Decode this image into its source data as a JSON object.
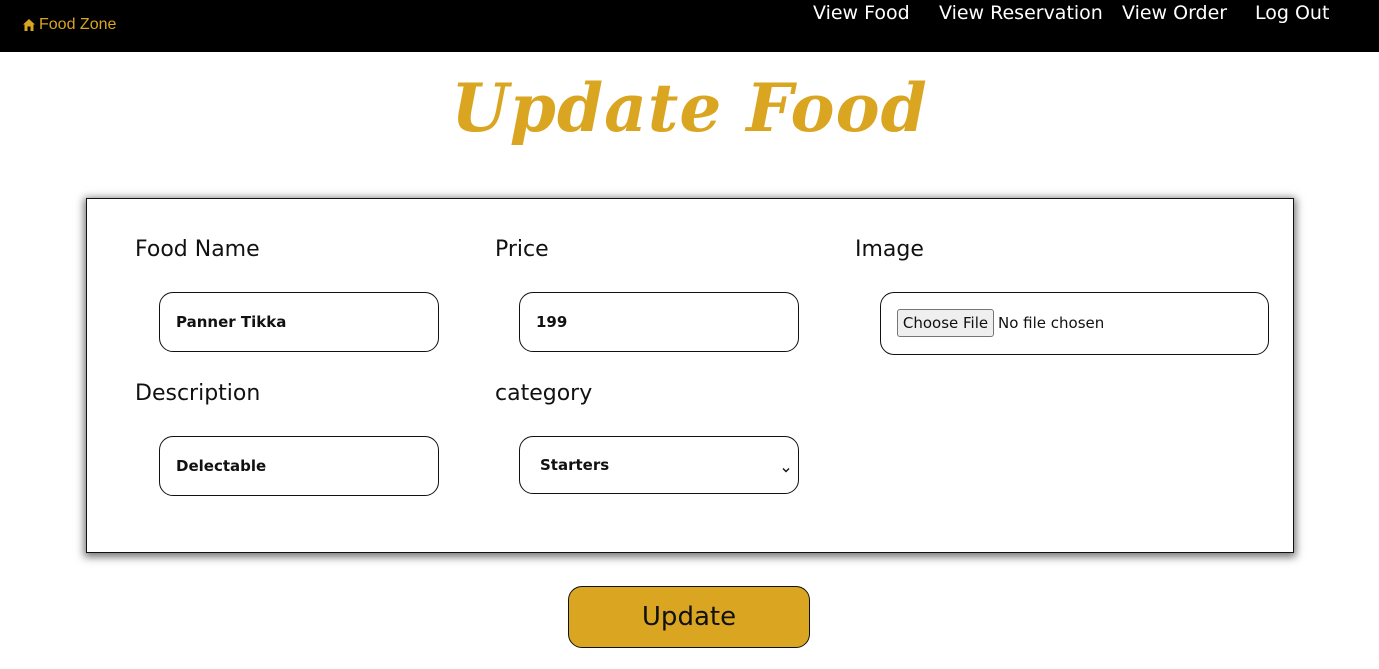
{
  "navbar": {
    "brand": {
      "label": "Food Zone",
      "icon": "home-icon"
    },
    "links": [
      {
        "label": "View Food"
      },
      {
        "label": "View Reservation"
      },
      {
        "label": "View Order"
      },
      {
        "label": "Log Out"
      }
    ]
  },
  "page": {
    "title": "Update Food"
  },
  "form": {
    "food_name": {
      "label": "Food Name",
      "value": "Panner Tikka"
    },
    "price": {
      "label": "Price",
      "value": "199"
    },
    "image": {
      "label": "Image",
      "button_label": "Choose File",
      "status": "No file chosen"
    },
    "description": {
      "label": "Description",
      "value": "Delectable"
    },
    "category": {
      "label": "category",
      "selected": "Starters",
      "icon": "chevron-down-icon"
    },
    "submit_label": "Update"
  },
  "colors": {
    "accent": "#DAA520",
    "navbar_bg": "#000000",
    "text": "#111111"
  }
}
